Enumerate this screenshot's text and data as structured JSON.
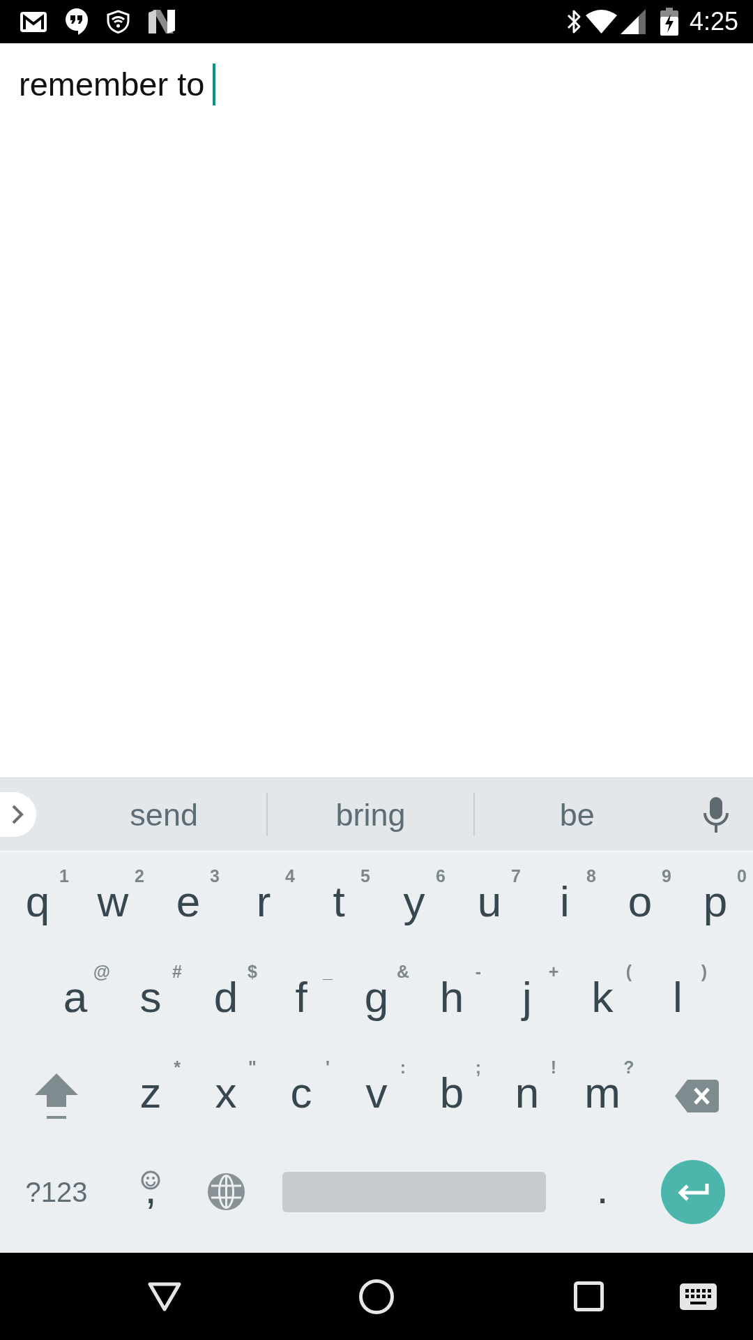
{
  "status_bar": {
    "time": "4:25"
  },
  "editor": {
    "value": "remember to",
    "focused": true
  },
  "keyboard": {
    "suggestions": [
      "send",
      "bring",
      "be"
    ],
    "letter_rows": [
      [
        {
          "label": "q",
          "hint": "1"
        },
        {
          "label": "w",
          "hint": "2"
        },
        {
          "label": "e",
          "hint": "3"
        },
        {
          "label": "r",
          "hint": "4"
        },
        {
          "label": "t",
          "hint": "5"
        },
        {
          "label": "y",
          "hint": "6"
        },
        {
          "label": "u",
          "hint": "7"
        },
        {
          "label": "i",
          "hint": "8"
        },
        {
          "label": "o",
          "hint": "9"
        },
        {
          "label": "p",
          "hint": "0"
        }
      ],
      [
        {
          "label": "a",
          "hint": "@"
        },
        {
          "label": "s",
          "hint": "#"
        },
        {
          "label": "d",
          "hint": "$"
        },
        {
          "label": "f",
          "hint": "_"
        },
        {
          "label": "g",
          "hint": "&"
        },
        {
          "label": "h",
          "hint": "-"
        },
        {
          "label": "j",
          "hint": "+"
        },
        {
          "label": "k",
          "hint": "("
        },
        {
          "label": "l",
          "hint": ")"
        }
      ],
      [
        {
          "label": "z",
          "hint": "*"
        },
        {
          "label": "x",
          "hint": "\""
        },
        {
          "label": "c",
          "hint": "'"
        },
        {
          "label": "v",
          "hint": ":"
        },
        {
          "label": "b",
          "hint": ";"
        },
        {
          "label": "n",
          "hint": "!"
        },
        {
          "label": "m",
          "hint": "?"
        }
      ]
    ],
    "symbols_key": "?123",
    "comma_key": ",",
    "period_key": "."
  }
}
